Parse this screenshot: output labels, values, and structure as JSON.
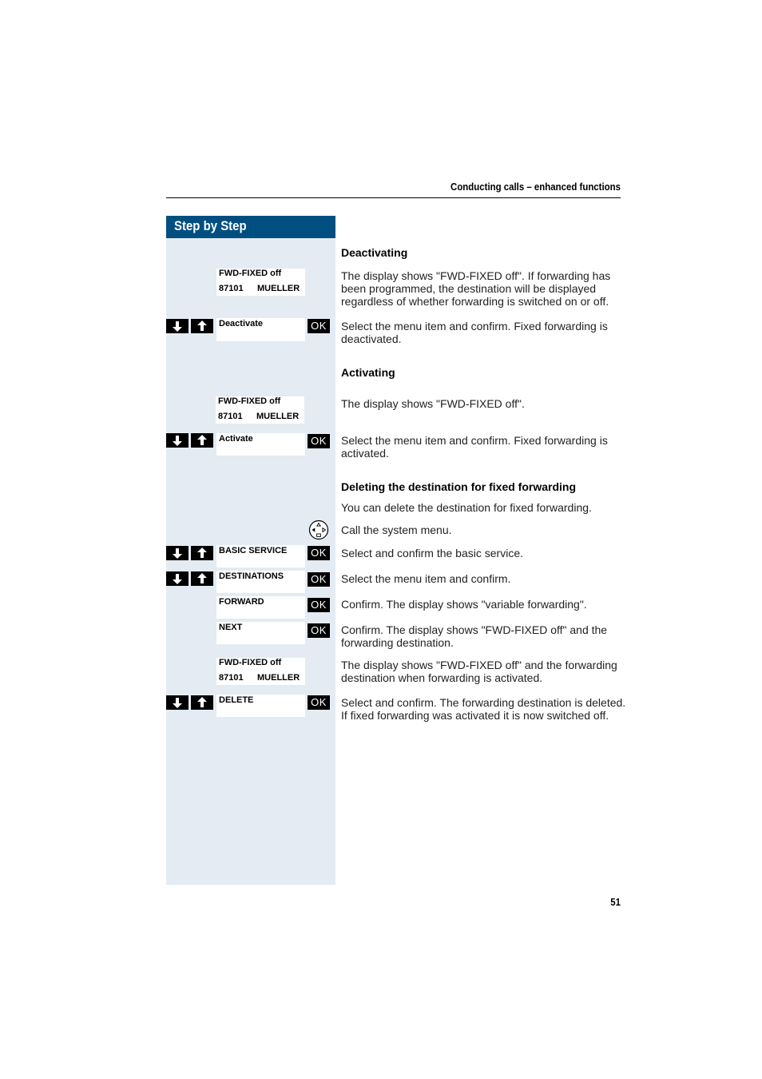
{
  "header": {
    "title": "Conducting calls – enhanced functions"
  },
  "sidebar": {
    "title": "Step by Step"
  },
  "sections": {
    "deactivating": {
      "heading": "Deactivating",
      "display": {
        "line1": "FWD-FIXED off",
        "line2_num": "87101",
        "line2_name": "MUELLER"
      },
      "display_text": "The display shows \"FWD-FIXED off\". If forwarding has been programmed, the destination will be displayed regardless of whether forwarding is switched on or off.",
      "menu_item": "Deactivate",
      "menu_text": "Select the menu item and confirm. Fixed forwarding is deactivated."
    },
    "activating": {
      "heading": "Activating",
      "display": {
        "line1": "FWD-FIXED off",
        "line2_num": "87101",
        "line2_name": "MUELLER"
      },
      "display_text": "The display shows \"FWD-FIXED off\".",
      "menu_item": "Activate",
      "menu_text": "Select the menu item and confirm. Fixed forwarding is activated."
    },
    "deleting": {
      "heading": "Deleting the destination for fixed forwarding",
      "intro": "You can delete the destination for fixed forwarding.",
      "system_menu_text": "Call the system menu.",
      "steps": [
        {
          "item": "BASIC SERVICE",
          "text": "Select and confirm the basic service."
        },
        {
          "item": "DESTINATIONS",
          "text": "Select the menu item and confirm."
        },
        {
          "item": "FORWARD",
          "text": "Confirm. The display shows \"variable forwarding\"."
        },
        {
          "item": "NEXT",
          "text": "Confirm. The display shows \"FWD-FIXED off\" and the forwarding destination."
        }
      ],
      "display": {
        "line1": "FWD-FIXED off",
        "line2_num": "87101",
        "line2_name": "MUELLER"
      },
      "display_text": "The display shows \"FWD-FIXED off\" and the forwarding destination when forwarding is activated.",
      "delete_item": "DELETE",
      "delete_text": "Select and confirm. The forwarding destination is deleted. If fixed forwarding was activated it is now switched off."
    }
  },
  "keys": {
    "ok_label": "OK"
  },
  "icons": {
    "down": "arrow-down-key",
    "up": "arrow-up-key",
    "nav": "navigation-key"
  },
  "footer": {
    "page_number": "51"
  },
  "colors": {
    "brand": "#004f80",
    "sidebar_bg": "#e4ebf2"
  }
}
